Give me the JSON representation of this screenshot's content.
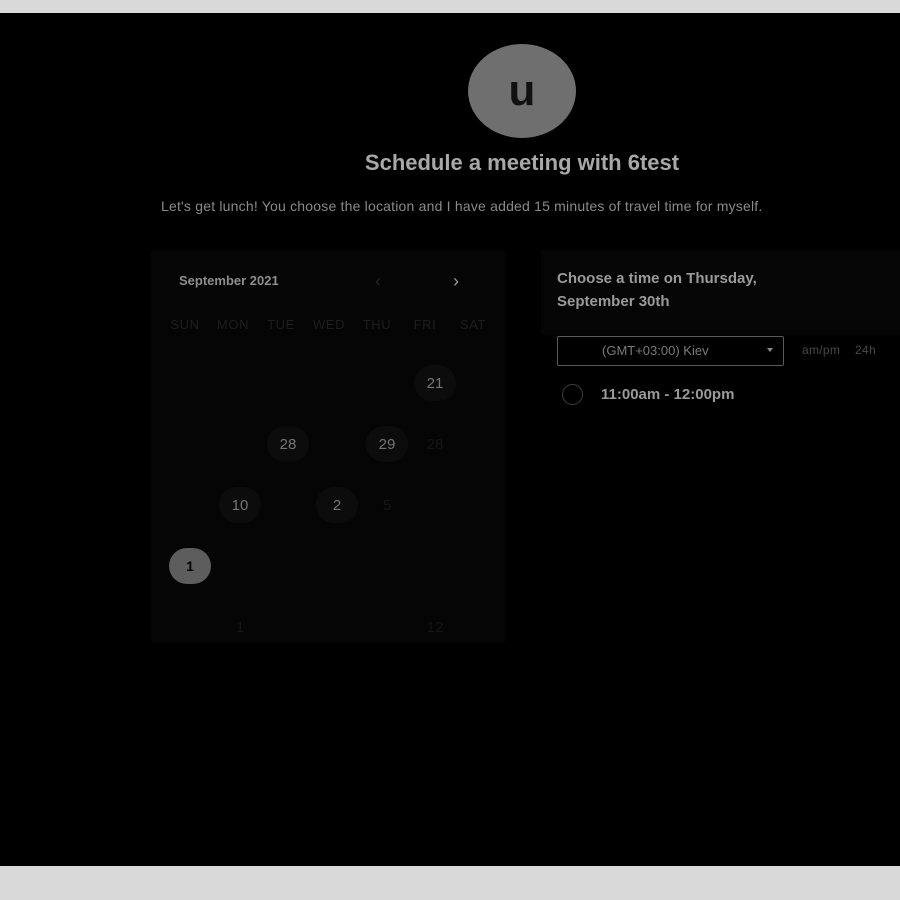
{
  "host": {
    "avatar_initial": "u",
    "title": "Schedule a meeting with 6test",
    "description": "Let's get lunch! You choose the location and I have added 15 minutes of travel time for myself."
  },
  "calendar": {
    "month_label": "September 2021",
    "prev_icon": "‹",
    "next_icon": "›",
    "weekdays": [
      "SUN",
      "MON",
      "TUE",
      "WED",
      "THU",
      "FRI",
      "SAT"
    ],
    "days": [
      {
        "label": "21",
        "state": "available"
      },
      {
        "label": "28",
        "state": "available"
      },
      {
        "label": "29",
        "state": "available"
      },
      {
        "label": "28",
        "state": "faint"
      },
      {
        "label": "10",
        "state": "available"
      },
      {
        "label": "2",
        "state": "available"
      },
      {
        "label": "5",
        "state": "faint"
      },
      {
        "label": "1",
        "state": "selected"
      },
      {
        "label": "12",
        "state": "faint"
      },
      {
        "label": "1",
        "state": "faint"
      }
    ]
  },
  "times": {
    "heading": "Choose a time on Thursday, September 30th",
    "timezone": "(GMT+03:00) Kiev",
    "format_12h": "am/pm",
    "format_24h": "24h",
    "slots": [
      "11:00am - 12:00pm"
    ]
  },
  "colors": {
    "background": "#000000",
    "selected_day": "#5d5d5d",
    "avatar": "#6f6f6f"
  }
}
